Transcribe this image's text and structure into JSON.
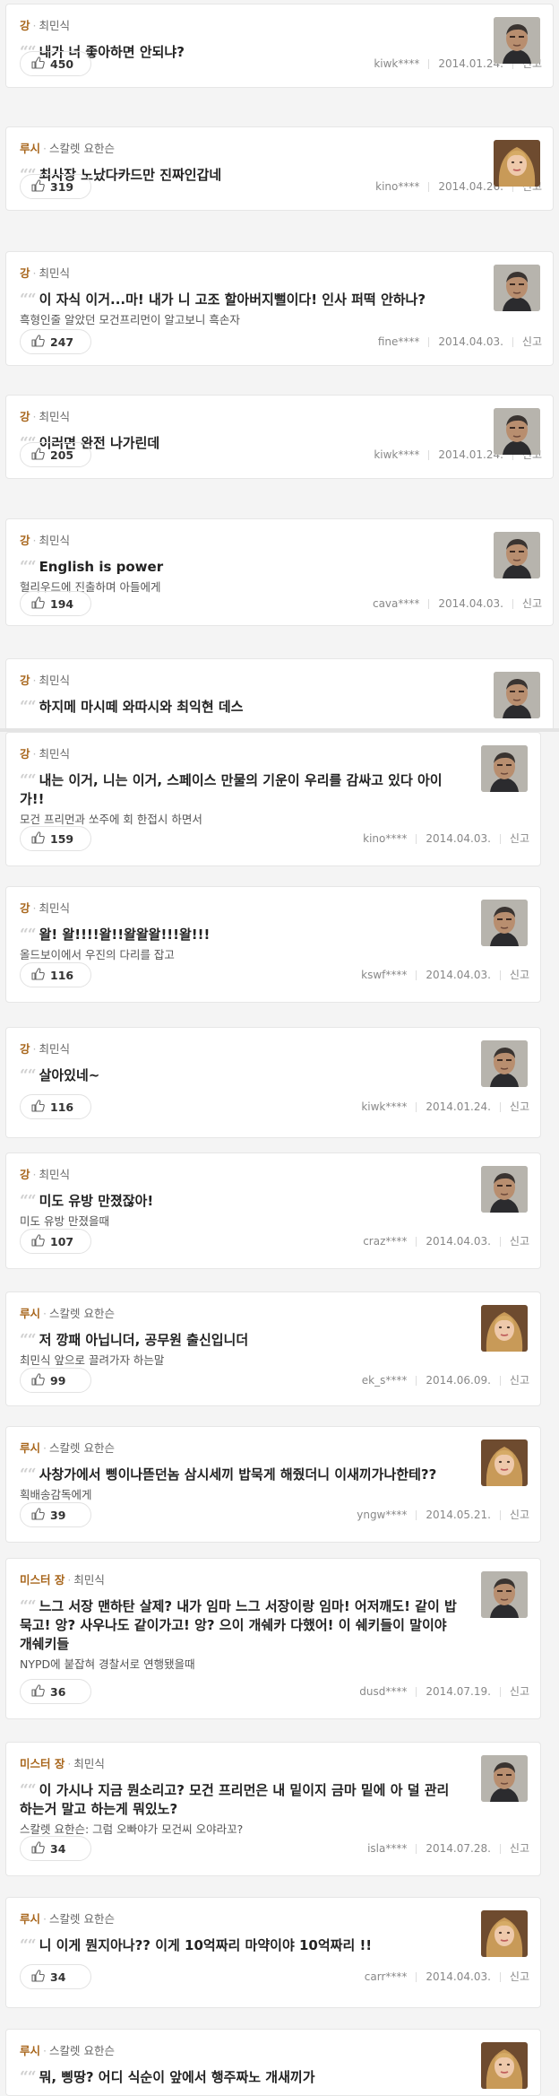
{
  "report_label": "신고",
  "comments": [
    {
      "character": "강",
      "actor": "최민식",
      "photo": "man",
      "quote": "내가 너 좋아하면 안되냐?",
      "desc": "",
      "likes": "450",
      "user": "kiwk****",
      "date": "2014.01.24."
    },
    {
      "character": "루시",
      "actor": "스칼렛 요한슨",
      "photo": "woman",
      "quote": "최사장 노났다카드만 진짜인갑네",
      "desc": "",
      "likes": "319",
      "user": "kino****",
      "date": "2014.04.26."
    },
    {
      "character": "강",
      "actor": "최민식",
      "photo": "man",
      "quote": "이 자식 이거...마! 내가 니 고조 할아버지뻘이다! 인사 퍼떡 안하나?",
      "desc": "흑형인줄 알았던 모건프리먼이 알고보니 흑손자",
      "likes": "247",
      "user": "fine****",
      "date": "2014.04.03."
    },
    {
      "character": "강",
      "actor": "최민식",
      "photo": "man",
      "quote": "이러면 완전 나가린데",
      "desc": "",
      "likes": "205",
      "user": "kiwk****",
      "date": "2014.01.24."
    },
    {
      "character": "강",
      "actor": "최민식",
      "photo": "man",
      "quote": "English is power",
      "desc": "헐리우드에 진출하며 아들에게",
      "likes": "194",
      "user": "cava****",
      "date": "2014.04.03."
    },
    {
      "character": "강",
      "actor": "최민식",
      "photo": "man",
      "quote": "하지메 마시떼 와따시와 최익현 데스",
      "desc": "",
      "likes": "",
      "user": "",
      "date": ""
    },
    {
      "character": "강",
      "actor": "최민식",
      "photo": "man",
      "quote": "내는 이거, 니는 이거, 스페이스 만물의 기운이 우리를 감싸고 있다 아이가!!",
      "desc": "모건 프리먼과 쏘주에 회 한접시 하면서",
      "likes": "159",
      "user": "kino****",
      "date": "2014.04.03."
    },
    {
      "character": "강",
      "actor": "최민식",
      "photo": "man",
      "quote": "왈! 왈!!!!왈!!왈왈왈!!!왈!!!",
      "desc": "올드보이에서 우진의 다리를 잡고",
      "likes": "116",
      "user": "kswf****",
      "date": "2014.04.03."
    },
    {
      "character": "강",
      "actor": "최민식",
      "photo": "man",
      "quote": "살아있네~",
      "desc": "",
      "likes": "116",
      "user": "kiwk****",
      "date": "2014.01.24."
    },
    {
      "character": "강",
      "actor": "최민식",
      "photo": "man",
      "quote": "미도 유방 만졌잖아!",
      "desc": "미도 유방 만졌을때",
      "likes": "107",
      "user": "craz****",
      "date": "2014.04.03."
    },
    {
      "character": "루시",
      "actor": "스칼렛 요한슨",
      "photo": "woman",
      "quote": "저 깡패 아닙니더, 공무원 출신입니더",
      "desc": "최민식 앞으로 끌려가자 하는말",
      "likes": "99",
      "user": "ek_s****",
      "date": "2014.06.09."
    },
    {
      "character": "루시",
      "actor": "스칼렛 요한슨",
      "photo": "woman",
      "quote": "사창가에서 삥이나뜯던놈 삼시세끼 밥묵게 해줬더니 이새끼가나한테??",
      "desc": "획배송감독에게",
      "likes": "39",
      "user": "yngw****",
      "date": "2014.05.21."
    },
    {
      "character": "미스터 장",
      "actor": "최민식",
      "photo": "man",
      "quote": "느그 서장 맨하탄 살제? 내가 임마 느그 서장이랑 임마! 어저깨도! 같이 밥묵고! 앙? 사우나도 같이가고! 앙? 으이 개쉐카 다했어! 이 쉐키들이 말이야 개쉐키들",
      "desc": "NYPD에 붙잡혀 경찰서로 연행됐을때",
      "likes": "36",
      "user": "dusd****",
      "date": "2014.07.19."
    },
    {
      "character": "미스터 장",
      "actor": "최민식",
      "photo": "man",
      "quote": "이 가시나 지금 뭔소리고? 모건 프리먼은 내 밑이지 금마 밑에 아 덜 관리 하는거 말고 하는게 뭐있노?",
      "desc": "스칼렛 요한슨: 그럼 오빠야가 모건씨 오야라꼬?",
      "likes": "34",
      "user": "isla****",
      "date": "2014.07.28."
    },
    {
      "character": "루시",
      "actor": "스칼렛 요한슨",
      "photo": "woman",
      "quote": "니 이게 뭔지아나?? 이게 10억짜리 마약이야 10억짜리 !!",
      "desc": "",
      "likes": "34",
      "user": "carr****",
      "date": "2014.04.03."
    },
    {
      "character": "루시",
      "actor": "스칼렛 요한슨",
      "photo": "woman",
      "quote": "뭐, 삥땅? 어디 식순이 앞에서 행주짜노 개새끼가",
      "desc": "",
      "likes": "",
      "user": "",
      "date": ""
    }
  ]
}
